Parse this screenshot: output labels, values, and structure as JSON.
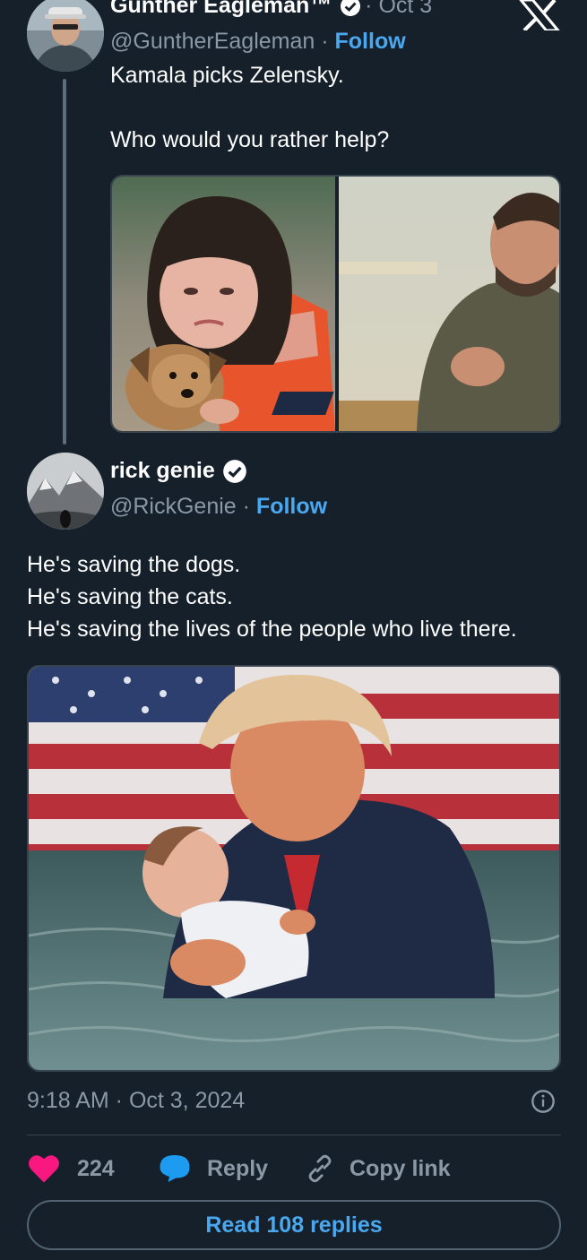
{
  "parent_tweet": {
    "display_name": "Gunther Eagleman™",
    "date": "· Oct 3",
    "handle": "@GuntherEagleman · ",
    "follow_label": "Follow",
    "text_line1": "Kamala picks Zelensky.",
    "text_line2": "Who would you rather help?",
    "media": [
      {
        "icon": "photo-crying-girl-with-puppy"
      },
      {
        "icon": "photo-zelensky-at-table"
      }
    ]
  },
  "reply_tweet": {
    "display_name": "rick genie",
    "handle": "@RickGenie · ",
    "follow_label": "Follow",
    "text_lines": [
      "He's saving the dogs.",
      "He's saving the cats.",
      "He's saving the lives of the people who live there."
    ],
    "media": {
      "icon": "photo-man-carrying-baby-in-flood"
    }
  },
  "meta": {
    "timestamp": "9:18 AM · Oct 3, 2024"
  },
  "actions": {
    "like_count": "224",
    "reply_label": "Reply",
    "copy_label": "Copy link",
    "read_replies_label": "Read 108 replies"
  },
  "colors": {
    "background": "#15202b",
    "accent": "#1d9bf0",
    "like": "#f91880",
    "secondary_text": "#8b98a5"
  },
  "icons": [
    "x-logo-icon",
    "verified-icon",
    "info-icon",
    "heart-icon",
    "reply-icon",
    "link-icon"
  ]
}
